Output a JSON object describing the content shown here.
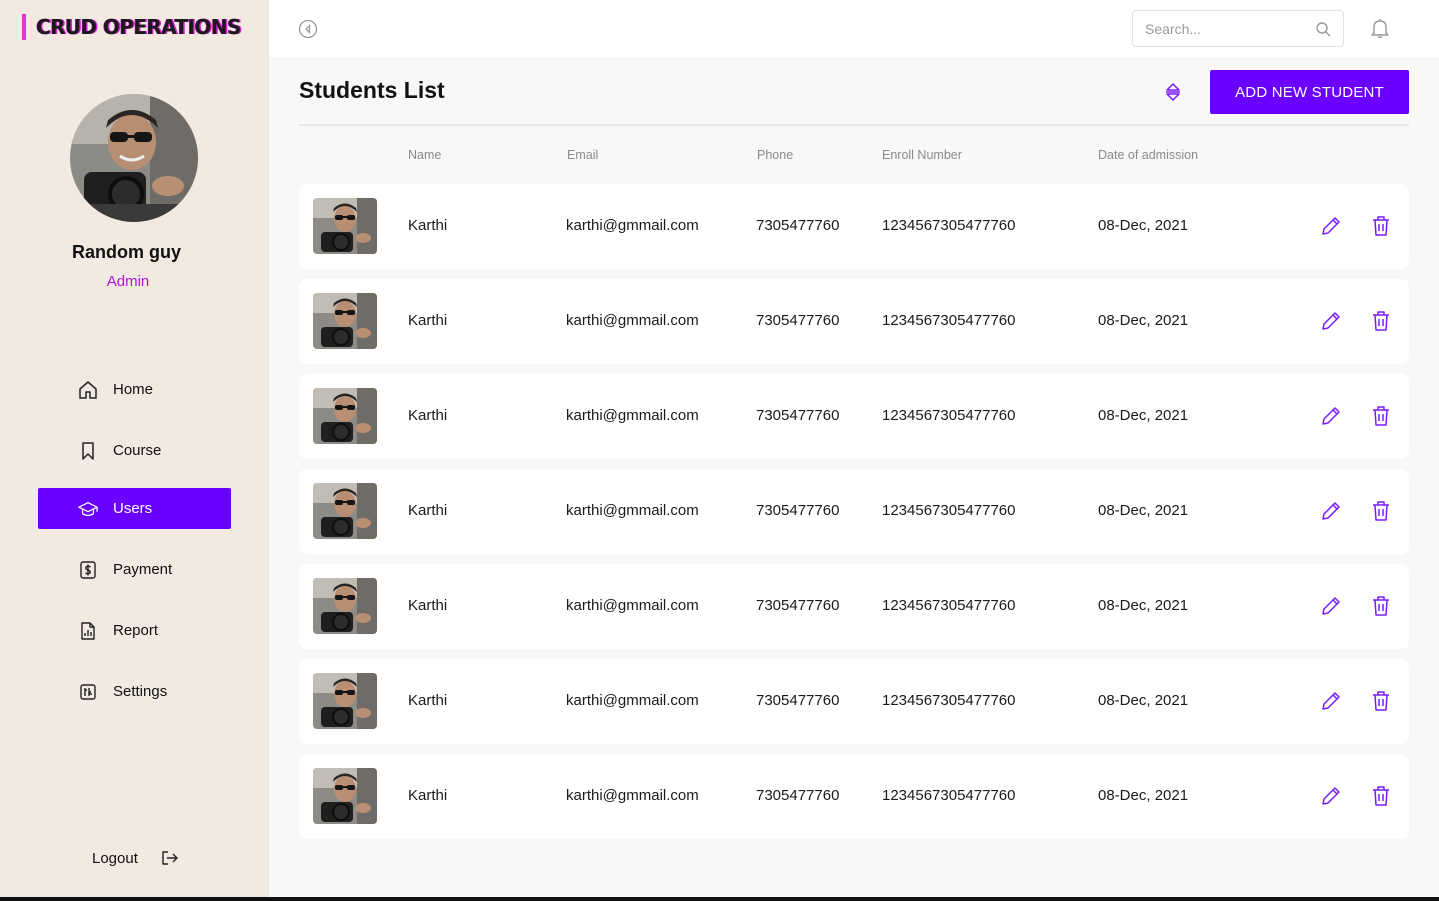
{
  "app": {
    "brand": "CRUD OPERATIONS",
    "accent_color": "#6a00ff",
    "brand_color": "#d323d1",
    "sidebar_bg": "#f2eae1"
  },
  "profile": {
    "name": "Random guy",
    "role": "Admin"
  },
  "nav": [
    {
      "label": "Home",
      "icon": "home-icon",
      "active": false
    },
    {
      "label": "Course",
      "icon": "bookmark-icon",
      "active": false
    },
    {
      "label": "Users",
      "icon": "graduation-cap-icon",
      "active": true
    },
    {
      "label": "Payment",
      "icon": "dollar-file-icon",
      "active": false
    },
    {
      "label": "Report",
      "icon": "report-file-icon",
      "active": false
    },
    {
      "label": "Settings",
      "icon": "settings-icon",
      "active": false
    }
  ],
  "logout": {
    "label": "Logout",
    "icon": "logout-icon"
  },
  "search": {
    "placeholder": "Search...",
    "value": ""
  },
  "page": {
    "title": "Students List",
    "add_button": "ADD NEW STUDENT"
  },
  "table": {
    "headers": [
      "Name",
      "Email",
      "Phone",
      "Enroll Number",
      "Date of admission"
    ],
    "rows": [
      {
        "name": "Karthi",
        "email": "karthi@gmmail.com",
        "phone": "7305477760",
        "enroll": "1234567305477760",
        "date": "08-Dec, 2021"
      },
      {
        "name": "Karthi",
        "email": "karthi@gmmail.com",
        "phone": "7305477760",
        "enroll": "1234567305477760",
        "date": "08-Dec, 2021"
      },
      {
        "name": "Karthi",
        "email": "karthi@gmmail.com",
        "phone": "7305477760",
        "enroll": "1234567305477760",
        "date": "08-Dec, 2021"
      },
      {
        "name": "Karthi",
        "email": "karthi@gmmail.com",
        "phone": "7305477760",
        "enroll": "1234567305477760",
        "date": "08-Dec, 2021"
      },
      {
        "name": "Karthi",
        "email": "karthi@gmmail.com",
        "phone": "7305477760",
        "enroll": "1234567305477760",
        "date": "08-Dec, 2021"
      },
      {
        "name": "Karthi",
        "email": "karthi@gmmail.com",
        "phone": "7305477760",
        "enroll": "1234567305477760",
        "date": "08-Dec, 2021"
      },
      {
        "name": "Karthi",
        "email": "karthi@gmmail.com",
        "phone": "7305477760",
        "enroll": "1234567305477760",
        "date": "08-Dec, 2021"
      }
    ]
  }
}
